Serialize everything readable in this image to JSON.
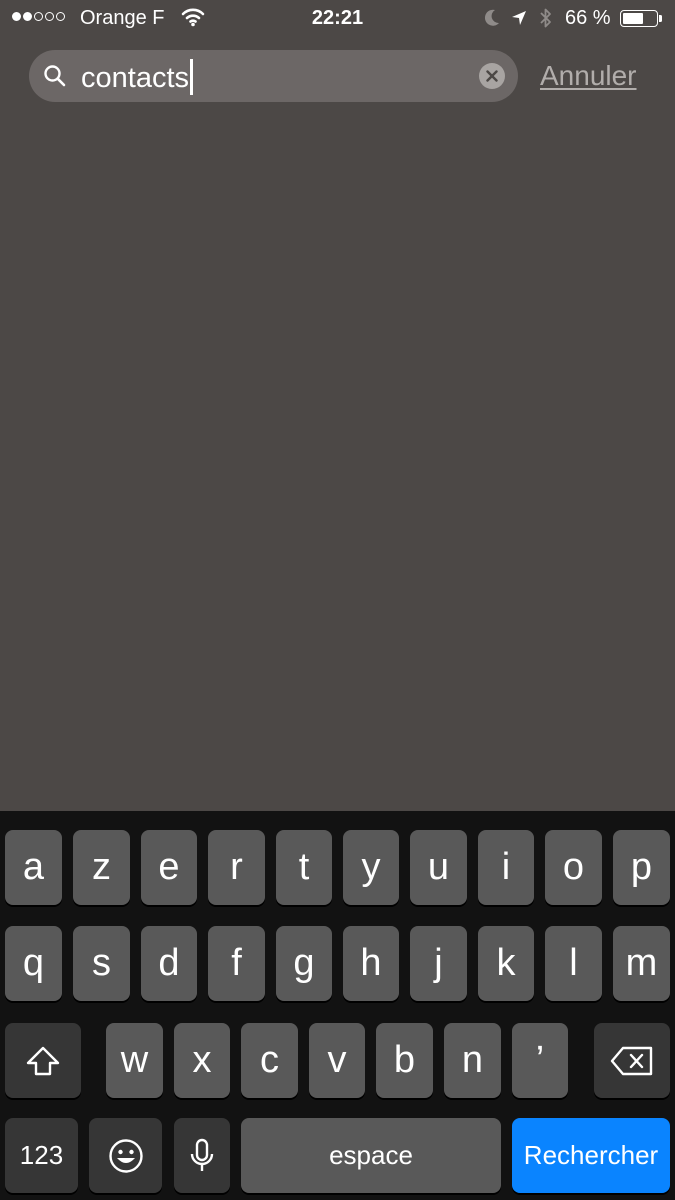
{
  "status_bar": {
    "signal_bars_filled": 2,
    "signal_bars_total": 5,
    "carrier": "Orange F",
    "time": "22:21",
    "battery_percent": "66 %",
    "battery_level": 0.66,
    "icons": [
      "wifi-icon",
      "moon-icon",
      "location-arrow-icon",
      "bluetooth-icon",
      "battery-icon"
    ]
  },
  "search": {
    "value": "contacts",
    "clear_icon": "clear-icon",
    "cancel_label": "Annuler"
  },
  "keyboard": {
    "row1": [
      "a",
      "z",
      "e",
      "r",
      "t",
      "y",
      "u",
      "i",
      "o",
      "p"
    ],
    "row2": [
      "q",
      "s",
      "d",
      "f",
      "g",
      "h",
      "j",
      "k",
      "l",
      "m"
    ],
    "row3": [
      "w",
      "x",
      "c",
      "v",
      "b",
      "n",
      "’"
    ],
    "numbers_label": "123",
    "space_label": "espace",
    "return_label": "Rechercher",
    "accent_color": "#0a84ff"
  }
}
